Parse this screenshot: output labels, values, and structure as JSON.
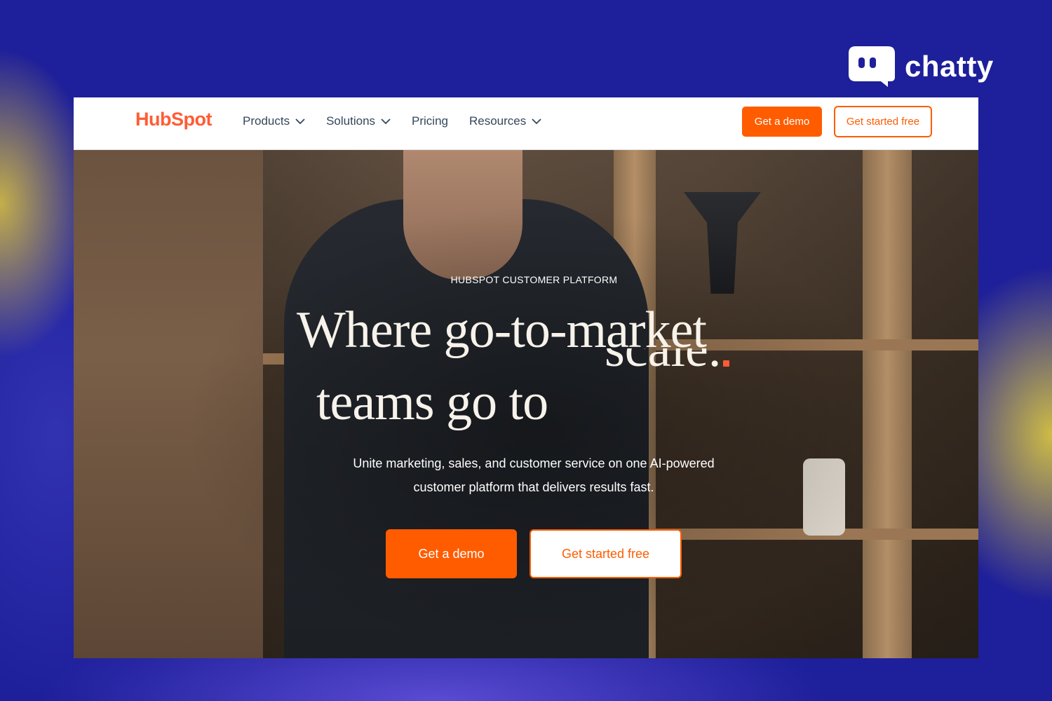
{
  "brand": {
    "name": "chatty",
    "icon": "chat-bubble-icon"
  },
  "header": {
    "logo": "HubSpot",
    "nav": [
      {
        "label": "Products",
        "has_dropdown": true
      },
      {
        "label": "Solutions",
        "has_dropdown": true
      },
      {
        "label": "Pricing",
        "has_dropdown": false
      },
      {
        "label": "Resources",
        "has_dropdown": true
      }
    ],
    "cta_demo": "Get a demo",
    "cta_free": "Get started free"
  },
  "hero": {
    "eyebrow": "HUBSPOT CUSTOMER PLATFORM",
    "headline_line1": "Where go-to-market",
    "headline_ghost": "scale.",
    "headline_line2": "teams go to",
    "subcopy": "Unite marketing, sales, and customer service on one AI-powered customer platform that delivers results fast.",
    "cta_demo": "Get a demo",
    "cta_free": "Get started free"
  },
  "colors": {
    "background": "#1e1f9a",
    "accent": "#ff5c00",
    "hubspot_orange": "#ff5c35"
  }
}
